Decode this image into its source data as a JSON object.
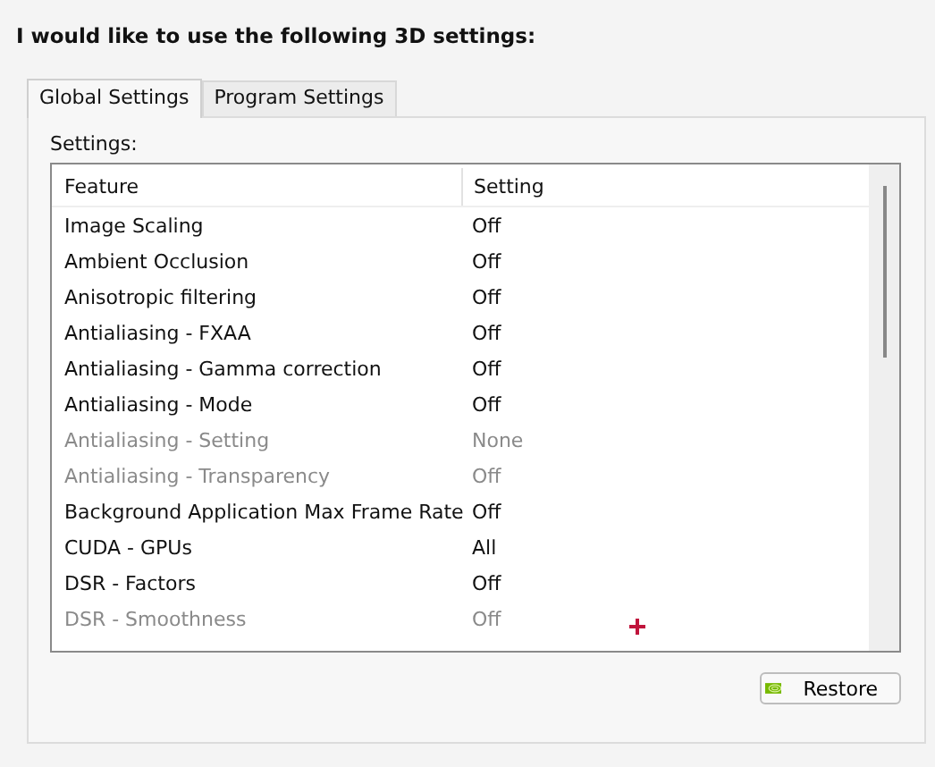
{
  "heading": "I would like to use the following 3D settings:",
  "tabs": [
    {
      "label": "Global Settings",
      "selected": true
    },
    {
      "label": "Program Settings",
      "selected": false
    }
  ],
  "settings_label": "Settings:",
  "table": {
    "columns": [
      "Feature",
      "Setting"
    ],
    "rows": [
      {
        "feature": "Image Scaling",
        "setting": "Off",
        "disabled": false
      },
      {
        "feature": "Ambient Occlusion",
        "setting": "Off",
        "disabled": false
      },
      {
        "feature": "Anisotropic filtering",
        "setting": "Off",
        "disabled": false
      },
      {
        "feature": "Antialiasing - FXAA",
        "setting": "Off",
        "disabled": false
      },
      {
        "feature": "Antialiasing - Gamma correction",
        "setting": "Off",
        "disabled": false
      },
      {
        "feature": "Antialiasing - Mode",
        "setting": "Off",
        "disabled": false
      },
      {
        "feature": "Antialiasing - Setting",
        "setting": "None",
        "disabled": true
      },
      {
        "feature": "Antialiasing - Transparency",
        "setting": "Off",
        "disabled": true
      },
      {
        "feature": "Background Application Max Frame Rate",
        "setting": "Off",
        "disabled": false
      },
      {
        "feature": "CUDA - GPUs",
        "setting": "All",
        "disabled": false
      },
      {
        "feature": "DSR - Factors",
        "setting": "Off",
        "disabled": false
      },
      {
        "feature": "DSR - Smoothness",
        "setting": "Off",
        "disabled": true
      }
    ]
  },
  "restore_button": "Restore"
}
